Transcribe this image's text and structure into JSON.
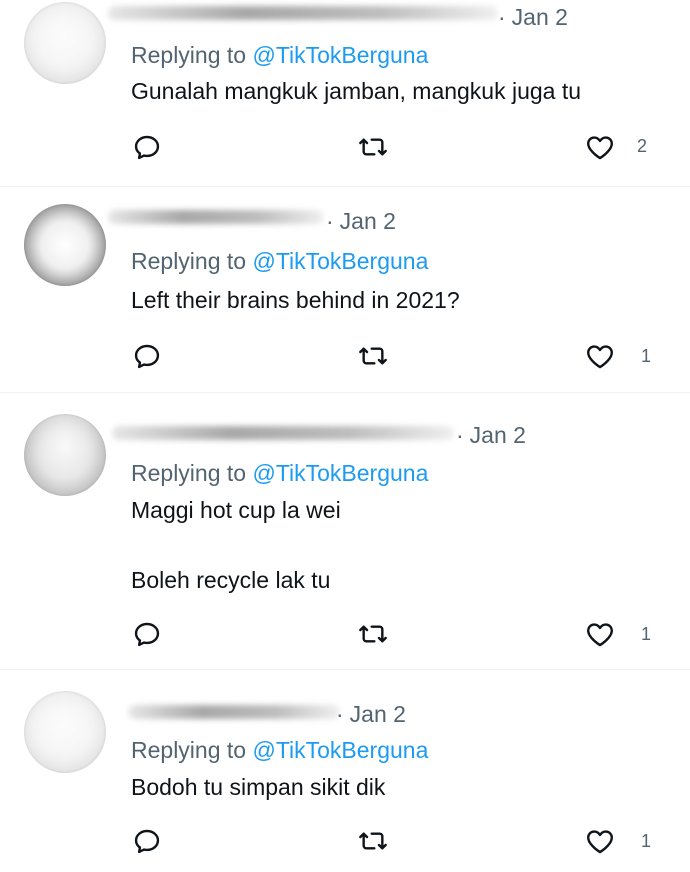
{
  "replies": [
    {
      "date": "Jan 2",
      "replying_prefix": "Replying to",
      "handle": "@TikTokBerguna",
      "lines": [
        "Gunalah mangkuk jamban, mangkuk juga tu"
      ],
      "like_count": "2"
    },
    {
      "date": "Jan 2",
      "replying_prefix": "Replying to",
      "handle": "@TikTokBerguna",
      "lines": [
        "Left their brains behind in 2021?"
      ],
      "like_count": "1"
    },
    {
      "date": "Jan 2",
      "replying_prefix": "Replying to",
      "handle": "@TikTokBerguna",
      "lines": [
        "Maggi hot cup la wei",
        "Boleh recycle lak tu"
      ],
      "like_count": "1"
    },
    {
      "date": "Jan 2",
      "replying_prefix": "Replying to",
      "handle": "@TikTokBerguna",
      "lines": [
        "Bodoh tu simpan sikit dik"
      ],
      "like_count": "1"
    }
  ],
  "icons": {
    "reply": "reply-icon",
    "retweet": "retweet-icon",
    "like": "heart-icon"
  },
  "colors": {
    "text": "#0f1419",
    "secondary": "#536471",
    "link": "#1d9bf0",
    "divider": "#eff3f4"
  }
}
